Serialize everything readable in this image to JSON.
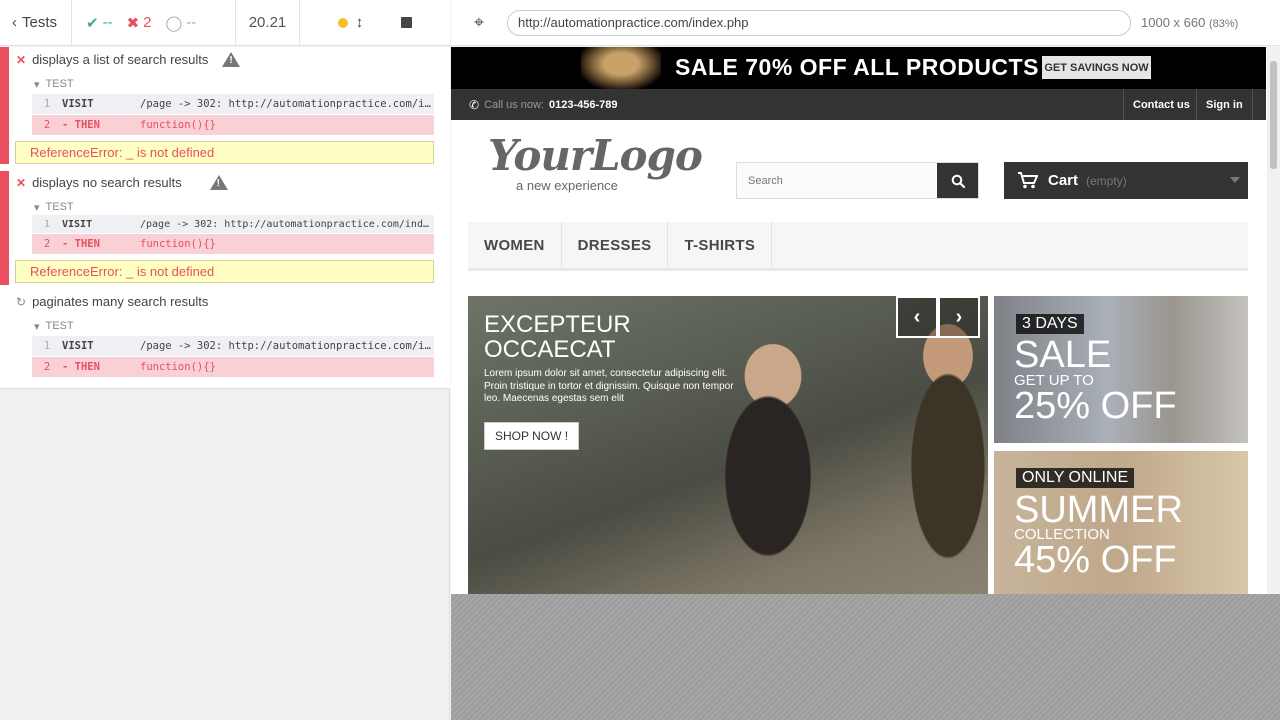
{
  "reporter": {
    "back_label": "Tests",
    "stats": {
      "passed": "--",
      "failed": "2",
      "pending": "--"
    },
    "duration": "20.21",
    "tests": [
      {
        "title": "displays a list of search results",
        "label": "TEST",
        "commands": [
          {
            "num": "1",
            "name": "VISIT",
            "message": "/page -> 302: http://automationpractice.com/index.php"
          },
          {
            "num": "2",
            "name": "- THEN",
            "message": "function(){}"
          }
        ],
        "error": "ReferenceError: _ is not defined"
      },
      {
        "title": "displays no search results",
        "label": "TEST",
        "commands": [
          {
            "num": "1",
            "name": "VISIT",
            "message": "/page -> 302: http://automationpractice.com/index.php"
          },
          {
            "num": "2",
            "name": "- THEN",
            "message": "function(){}"
          }
        ],
        "error": "ReferenceError: _ is not defined"
      },
      {
        "title": "paginates many search results",
        "label": "TEST",
        "commands": [
          {
            "num": "1",
            "name": "VISIT",
            "message": "/page -> 302: http://automationpractice.com/index.php"
          },
          {
            "num": "2",
            "name": "- THEN",
            "message": "function(){}"
          }
        ]
      }
    ]
  },
  "aut": {
    "url": "http://automationpractice.com/index.php",
    "viewport": "1000 x 660",
    "scale": "(83%)"
  },
  "site": {
    "banner_text": "SALE 70% OFF ALL PRODUCTS",
    "banner_button": "GET SAVINGS NOW",
    "call_label": "Call us now:",
    "phone": "0123-456-789",
    "contact": "Contact us",
    "signin": "Sign in",
    "logo_main": "YourLogo",
    "logo_sub": "a new experience",
    "search_placeholder": "Search",
    "cart_label": "Cart",
    "cart_status": "(empty)",
    "menu": [
      "WOMEN",
      "DRESSES",
      "T-SHIRTS"
    ],
    "slider": {
      "title_line1": "EXCEPTEUR",
      "title_line2": "OCCAECAT",
      "text": "Lorem ipsum dolor sit amet, consectetur adipiscing elit. Proin tristique in tortor et dignissim. Quisque non tempor leo. Maecenas egestas sem elit",
      "button": "SHOP NOW !"
    },
    "promo1": {
      "tag": "3 DAYS",
      "big": "SALE",
      "small": "GET UP TO",
      "pct": "25% OFF"
    },
    "promo2": {
      "tag": "ONLY ONLINE",
      "big": "SUMMER",
      "small": "COLLECTION",
      "pct": "45% OFF"
    }
  },
  "colors": {
    "fail": "#e94f5f",
    "pass": "#3eaf7c",
    "error_bg": "#ffffc4",
    "dark": "#333333"
  }
}
